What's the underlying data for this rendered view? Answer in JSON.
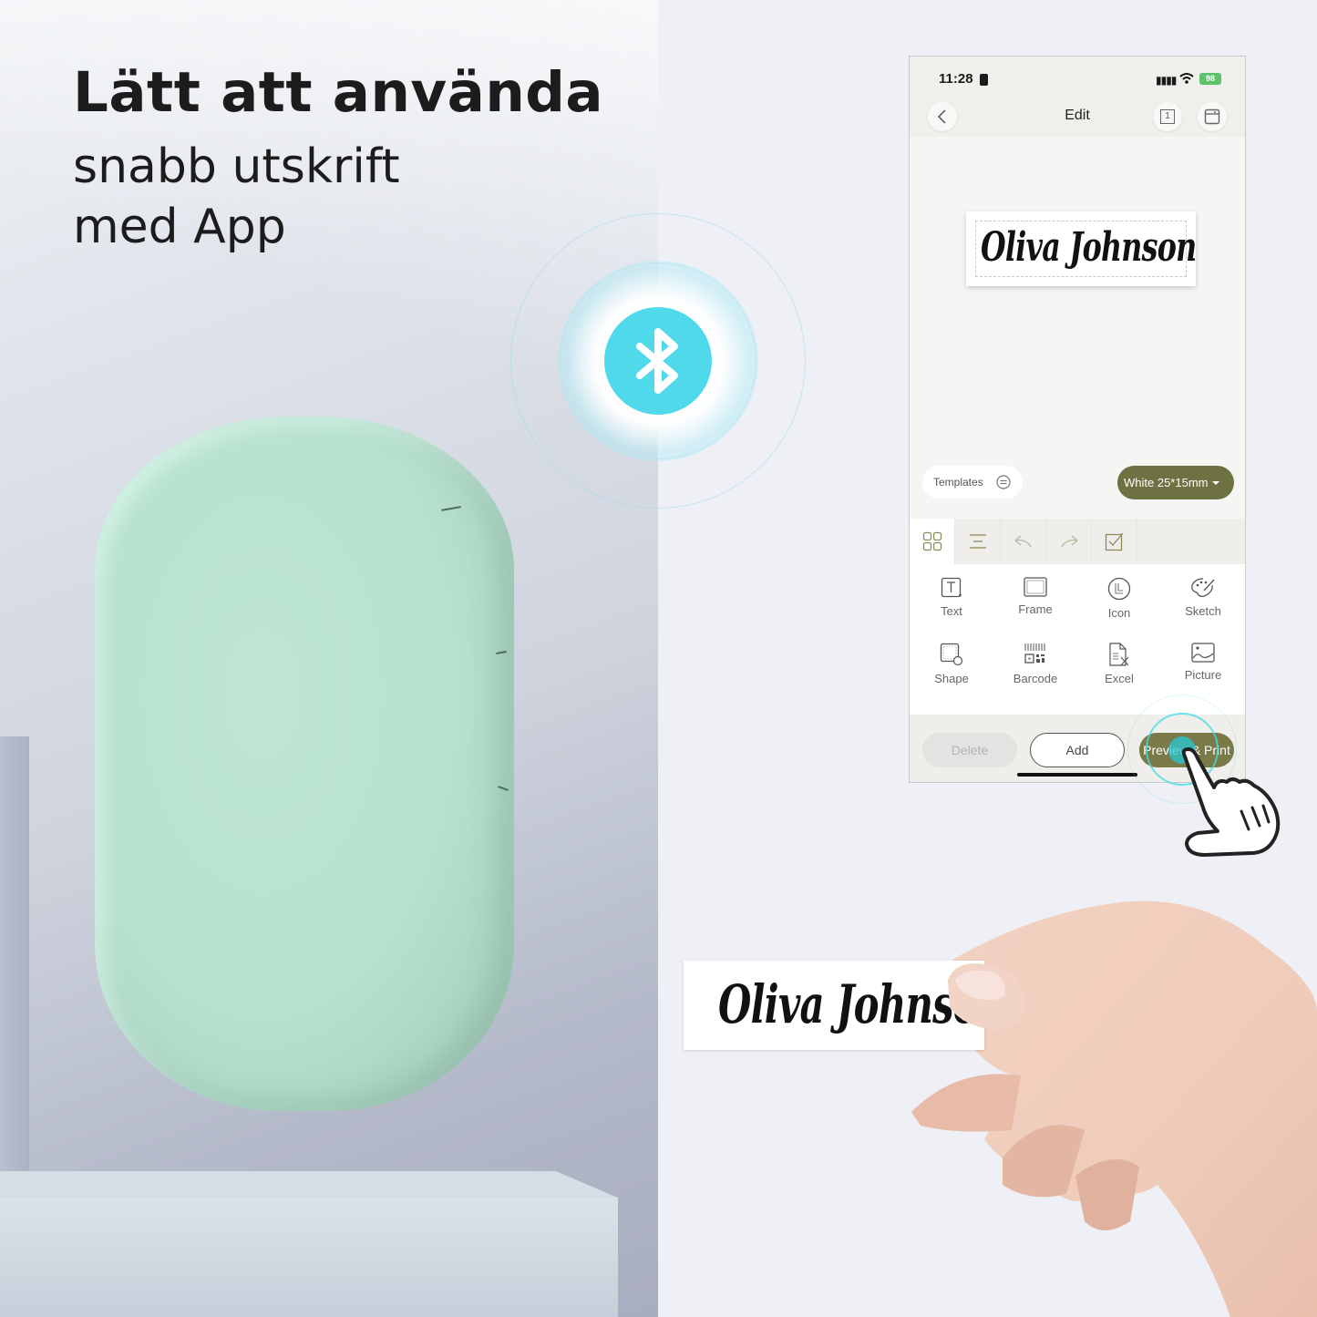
{
  "hero": {
    "title": "Lätt att använda",
    "subtitle_line1": "snabb utskrift",
    "subtitle_line2": "med App"
  },
  "bluetooth": {
    "icon": "bluetooth-icon",
    "color": "#4fd9ea"
  },
  "phone": {
    "status_bar": {
      "time": "11:28",
      "battery": "98"
    },
    "nav": {
      "title": "Edit",
      "page_indicator": "1"
    },
    "canvas": {
      "label_text": "Oliva Johnson"
    },
    "templates_label": "Templates",
    "label_size": "White 25*15mm",
    "toolbar_tabs": [
      {
        "icon": "grid-icon",
        "active": true
      },
      {
        "icon": "align-icon"
      },
      {
        "icon": "undo-icon"
      },
      {
        "icon": "redo-icon"
      },
      {
        "icon": "multi-select-icon"
      }
    ],
    "tools": [
      {
        "label": "Text",
        "icon": "text-icon"
      },
      {
        "label": "Frame",
        "icon": "frame-icon"
      },
      {
        "label": "Icon",
        "icon": "icon-library-icon"
      },
      {
        "label": "Sketch",
        "icon": "palette-icon"
      },
      {
        "label": "Shape",
        "icon": "shape-icon"
      },
      {
        "label": "Barcode",
        "icon": "barcode-icon"
      },
      {
        "label": "Excel",
        "icon": "excel-icon"
      },
      {
        "label": "Picture",
        "icon": "picture-icon"
      }
    ],
    "buttons": {
      "delete": "Delete",
      "add": "Add",
      "preview_print": "Preview & Print"
    },
    "accent_color": "#6e7141"
  },
  "printed_label": {
    "text": "Oliva Johnson"
  }
}
